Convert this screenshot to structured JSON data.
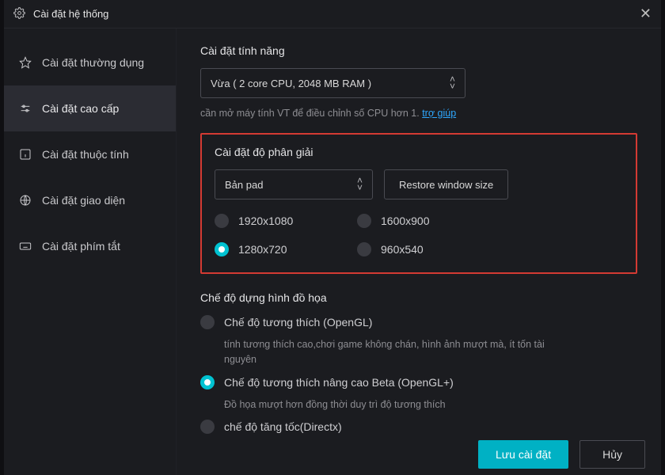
{
  "window": {
    "title": "Cài đặt hệ thống"
  },
  "sidebar": {
    "items": [
      {
        "label": "Cài đặt thường dụng"
      },
      {
        "label": "Cài đặt cao cấp"
      },
      {
        "label": "Cài đặt thuộc tính"
      },
      {
        "label": "Cài đặt giao diện"
      },
      {
        "label": "Cài đặt phím tắt"
      }
    ],
    "active_index": 1
  },
  "perf": {
    "title": "Cài đặt tính năng",
    "select_value": "Vừa ( 2 core CPU, 2048 MB RAM )",
    "hint_prefix": "cần mở máy tính VT để điều chỉnh số CPU hơn 1. ",
    "hint_link": "trợ giúp"
  },
  "resolution": {
    "title": "Cài đặt độ phân giải",
    "select_value": "Bản pad",
    "restore_button": "Restore window size",
    "options": [
      {
        "label": "1920x1080",
        "checked": false
      },
      {
        "label": "1600x900",
        "checked": false
      },
      {
        "label": "1280x720",
        "checked": true
      },
      {
        "label": "960x540",
        "checked": false
      }
    ]
  },
  "render": {
    "title": "Chế độ dựng hình đồ họa",
    "modes": [
      {
        "label": "Chế độ tương thích (OpenGL)",
        "checked": false,
        "desc": "tính tương thích cao,chơi game không chán, hình ảnh mượt mà, ít tốn tài nguyên"
      },
      {
        "label": "Chế độ tương thích nâng cao Beta (OpenGL+)",
        "checked": true,
        "desc": "Đồ họa mượt hơn đồng thời duy trì độ tương thích"
      },
      {
        "label": "chế độ tăng tốc(Directx)",
        "checked": false
      }
    ]
  },
  "footer": {
    "save": "Lưu cài đặt",
    "cancel": "Hủy"
  },
  "colors": {
    "accent": "#00b1c4",
    "highlight_border": "#d43a33"
  }
}
